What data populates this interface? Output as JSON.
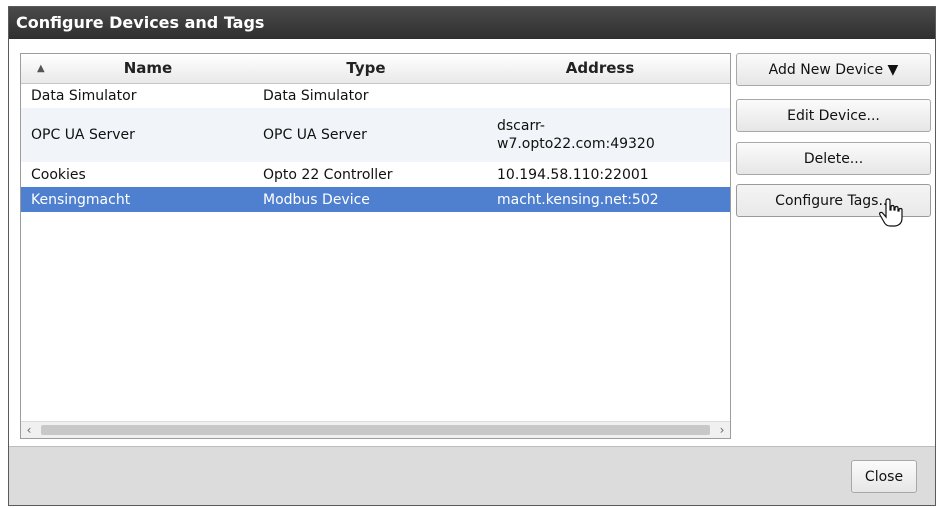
{
  "dialog": {
    "title": "Configure Devices and Tags"
  },
  "grid": {
    "columns": [
      "Name",
      "Type",
      "Address"
    ],
    "rows": [
      {
        "name": "Data Simulator",
        "type": "Data Simulator",
        "address": ""
      },
      {
        "name": "OPC UA Server",
        "type": "OPC UA Server",
        "address": "dscarr-w7.opto22.com:49320",
        "address_line1": "dscarr-",
        "address_line2": "w7.opto22.com:49320"
      },
      {
        "name": "Cookies",
        "type": "Opto 22 Controller",
        "address": "10.194.58.110:22001"
      },
      {
        "name": "Kensingmacht",
        "type": "Modbus Device",
        "address": "macht.kensing.net:502"
      }
    ],
    "selected_row": 3,
    "sort_icon": "sort-ascending-icon"
  },
  "actions": {
    "add_new_device": "Add New Device ▼",
    "edit_device": "Edit Device...",
    "delete": "Delete...",
    "configure_tags": "Configure Tags..."
  },
  "footer": {
    "close": "Close"
  },
  "colors": {
    "title_bar": "#3a3a3a",
    "selection": "#4f7fcf",
    "footer": "#dcdcdc"
  }
}
